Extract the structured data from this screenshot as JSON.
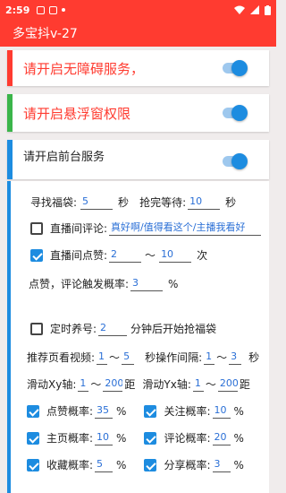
{
  "status": {
    "time": "2:59"
  },
  "app": {
    "title": "多宝抖v-27"
  },
  "perm_cards": [
    {
      "label": "请开启无障碍服务，",
      "accent": "#ff3b30",
      "on": true
    },
    {
      "label": "请开启悬浮窗权限",
      "accent": "#3bb54a",
      "on": true
    },
    {
      "label": "请开启前台服务",
      "accent": "#1d8ce0",
      "on": true
    }
  ],
  "settings": {
    "fudai": {
      "label": "寻找福袋:",
      "value": "5",
      "unit": "秒"
    },
    "wait": {
      "label": "抢完等待:",
      "value": "10",
      "unit": "秒"
    },
    "comment": {
      "label": "直播间评论:",
      "value": "真好啊/值得看这个/主播我看好",
      "checked": false
    },
    "like": {
      "label": "直播间点赞:",
      "from": "2",
      "to": "10",
      "unit": "次",
      "checked": true,
      "tilde": "～"
    },
    "like_comment": {
      "label": "点赞，评论触发概率:",
      "value": "3",
      "unit": "%"
    },
    "timer": {
      "label": "定时养号:",
      "value": "2",
      "suffix": "分钟后开始抢福袋",
      "checked": false
    },
    "video": {
      "label": "推荐页看视频:",
      "from": "1",
      "to": "5",
      "tilde": "～"
    },
    "interval": {
      "label": "秒操作间隔:",
      "from": "1",
      "to": "3",
      "unit": "秒",
      "tilde": "～"
    },
    "xy": {
      "label": "滑动Xy轴:",
      "from": "1",
      "to": "200",
      "unit": "距",
      "tilde": "～"
    },
    "yx": {
      "label": "滑动Yx轴:",
      "from": "1",
      "to": "200",
      "unit": "距",
      "tilde": "～"
    },
    "probs": [
      {
        "label": "点赞概率:",
        "value": "35",
        "unit": "%",
        "checked": true
      },
      {
        "label": "关注概率:",
        "value": "10",
        "unit": "%",
        "checked": true
      },
      {
        "label": "主页概率:",
        "value": "10",
        "unit": "%",
        "checked": true
      },
      {
        "label": "评论概率:",
        "value": "20",
        "unit": "%",
        "checked": true
      },
      {
        "label": "收藏概率:",
        "value": "5",
        "unit": "%",
        "checked": true
      },
      {
        "label": "分享概率:",
        "value": "3",
        "unit": "%",
        "checked": true
      }
    ]
  }
}
